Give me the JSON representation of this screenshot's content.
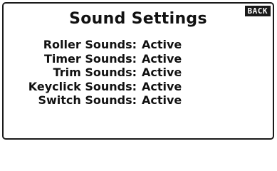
{
  "screen": {
    "title": "Sound Settings",
    "back_label": "BACK"
  },
  "settings": [
    {
      "label": "Roller Sounds:",
      "value": "Active"
    },
    {
      "label": "Timer Sounds:",
      "value": "Active"
    },
    {
      "label": "Trim Sounds:",
      "value": "Active"
    },
    {
      "label": "Keyclick Sounds:",
      "value": "Active"
    },
    {
      "label": "Switch Sounds:",
      "value": "Active"
    }
  ],
  "colors": {
    "foreground": "#111111",
    "background": "#ffffff",
    "back_button_bg": "#1a1a1a",
    "back_button_fg": "#ffffff"
  }
}
